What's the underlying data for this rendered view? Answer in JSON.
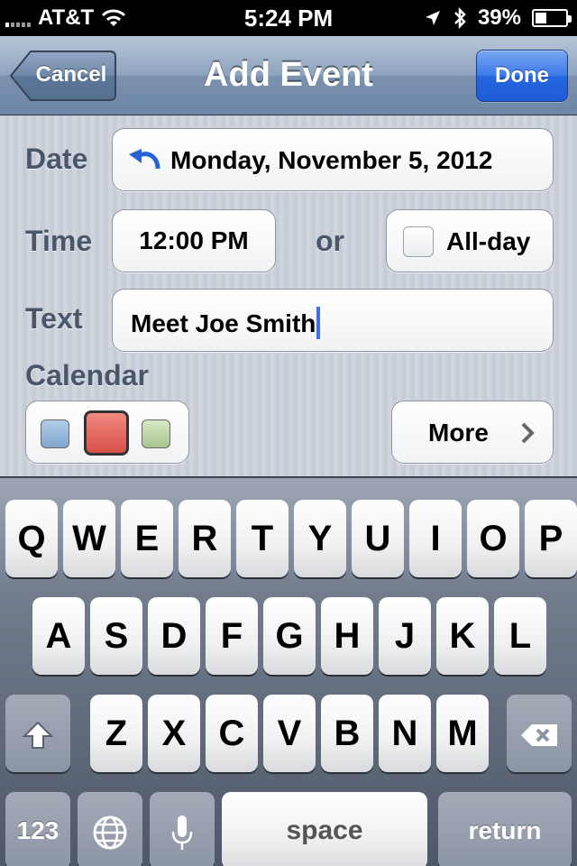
{
  "status_bar": {
    "carrier": "AT&T",
    "time": "5:24 PM",
    "battery": "39%",
    "battery_level": 0.39
  },
  "nav": {
    "cancel_label": "Cancel",
    "title": "Add Event",
    "done_label": "Done"
  },
  "form": {
    "date_label": "Date",
    "date_value": "Monday, November 5, 2012",
    "time_label": "Time",
    "time_value": "12:00 PM",
    "or_label": "or",
    "allday_label": "All-day",
    "allday_checked": false,
    "text_label": "Text",
    "text_value": "Meet Joe Smith",
    "calendar_label": "Calendar",
    "calendar_selected": "red",
    "more_label": "More"
  },
  "keyboard": {
    "row1": [
      "Q",
      "W",
      "E",
      "R",
      "T",
      "Y",
      "U",
      "I",
      "O",
      "P"
    ],
    "row2": [
      "A",
      "S",
      "D",
      "F",
      "G",
      "H",
      "J",
      "K",
      "L"
    ],
    "row3": [
      "Z",
      "X",
      "C",
      "V",
      "B",
      "N",
      "M"
    ],
    "numbers_label": "123",
    "space_label": "space",
    "return_label": "return"
  },
  "colors": {
    "nav_accent": "#6d86a6",
    "done_blue": "#2566e0",
    "cursor_blue": "#3b6ef0",
    "calendar_blue": "#80a6cf",
    "calendar_red": "#d8504a",
    "calendar_green": "#a8c48e"
  }
}
